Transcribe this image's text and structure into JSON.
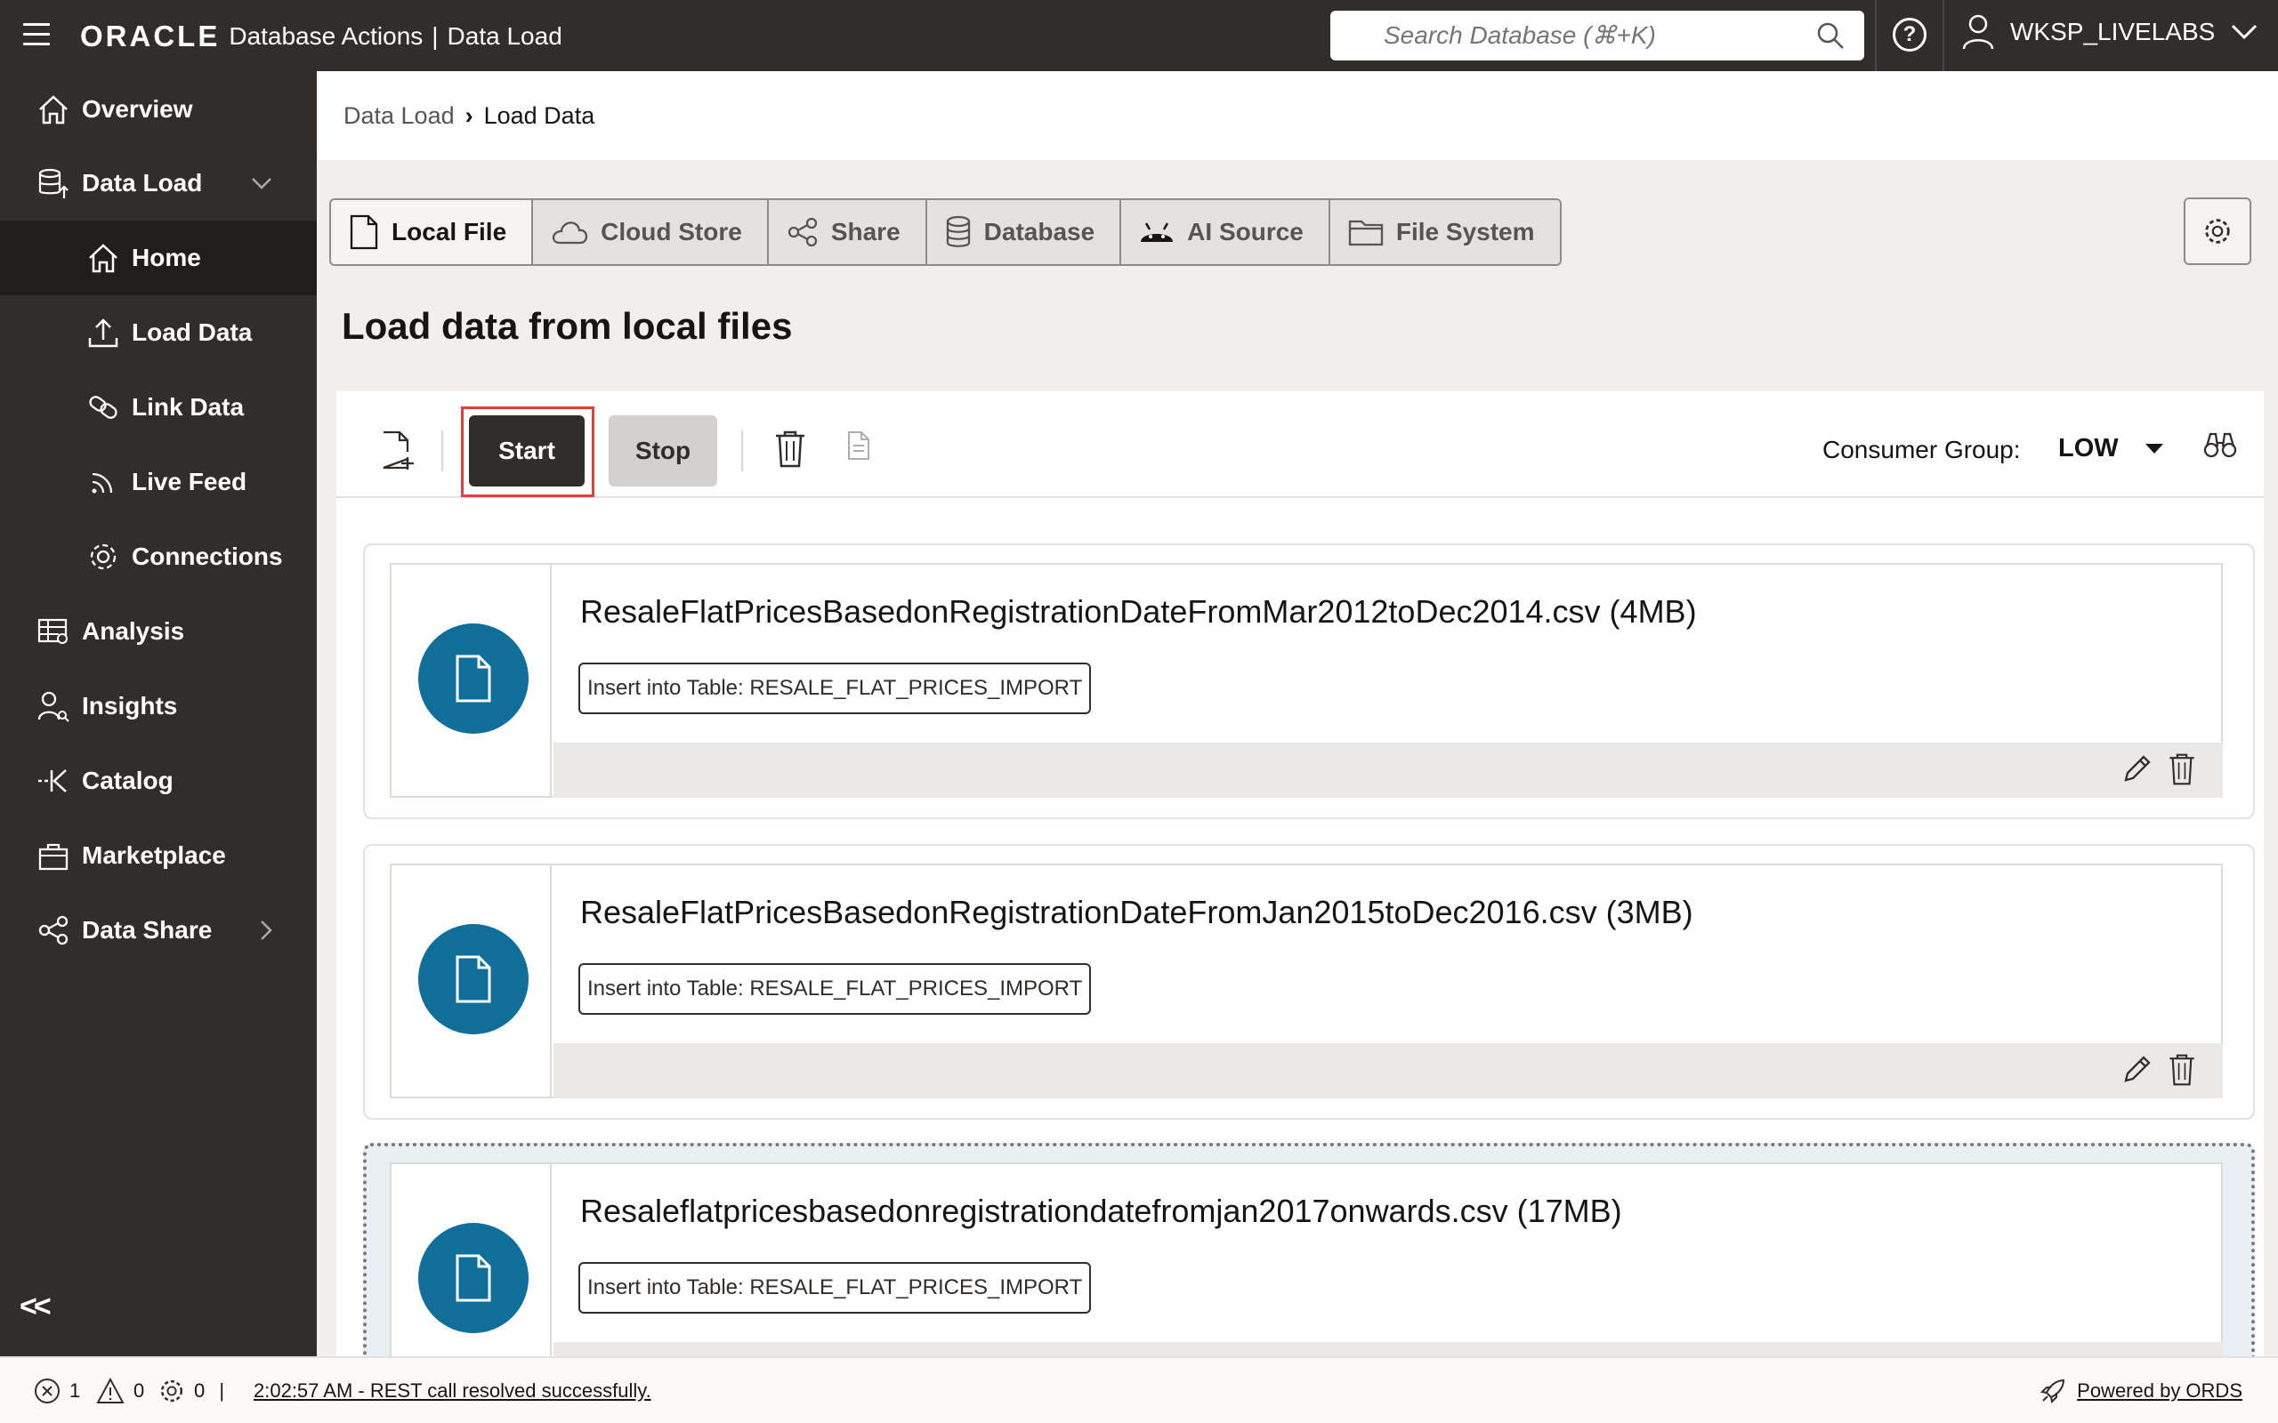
{
  "header": {
    "brand": "ORACLE",
    "app_name": "Database Actions",
    "page_name": "Data Load",
    "search_placeholder": "Search Database (⌘+K)",
    "user": "WKSP_LIVELABS"
  },
  "sidebar": {
    "items": [
      {
        "label": "Overview",
        "icon": "home-icon"
      },
      {
        "label": "Data Load",
        "icon": "data-load-icon"
      },
      {
        "label": "Home",
        "icon": "home-icon"
      },
      {
        "label": "Load Data",
        "icon": "upload-icon"
      },
      {
        "label": "Link Data",
        "icon": "link-icon"
      },
      {
        "label": "Live Feed",
        "icon": "feed-icon"
      },
      {
        "label": "Connections",
        "icon": "gear-icon"
      },
      {
        "label": "Analysis",
        "icon": "analysis-icon"
      },
      {
        "label": "Insights",
        "icon": "insights-icon"
      },
      {
        "label": "Catalog",
        "icon": "catalog-icon"
      },
      {
        "label": "Marketplace",
        "icon": "marketplace-icon"
      },
      {
        "label": "Data Share",
        "icon": "share-icon"
      }
    ],
    "collapse_label": "<<"
  },
  "breadcrumb": {
    "parent": "Data Load",
    "current": "Load Data"
  },
  "tabs": [
    {
      "label": "Local File"
    },
    {
      "label": "Cloud Store"
    },
    {
      "label": "Share"
    },
    {
      "label": "Database"
    },
    {
      "label": "AI Source"
    },
    {
      "label": "File System"
    }
  ],
  "page_title": "Load data from local files",
  "toolbar": {
    "start_label": "Start",
    "stop_label": "Stop",
    "consumer_group_label": "Consumer Group:",
    "consumer_group_value": "LOW"
  },
  "files": [
    {
      "name": "ResaleFlatPricesBasedonRegistrationDateFromMar2012toDec2014.csv (4MB)",
      "target": "Insert into Table: RESALE_FLAT_PRICES_IMPORT"
    },
    {
      "name": "ResaleFlatPricesBasedonRegistrationDateFromJan2015toDec2016.csv (3MB)",
      "target": "Insert into Table: RESALE_FLAT_PRICES_IMPORT"
    },
    {
      "name": "Resaleflatpricesbasedonregistrationdatefromjan2017onwards.csv (17MB)",
      "target": "Insert into Table: RESALE_FLAT_PRICES_IMPORT"
    }
  ],
  "status": {
    "errors": "1",
    "warnings": "0",
    "jobs": "0",
    "message": "2:02:57 AM - REST call resolved successfully.",
    "powered_by": "Powered by ORDS"
  },
  "colors": {
    "header_bg": "#312d2a",
    "file_icon_bg": "#0f6e9a",
    "highlight": "#e0413c"
  }
}
